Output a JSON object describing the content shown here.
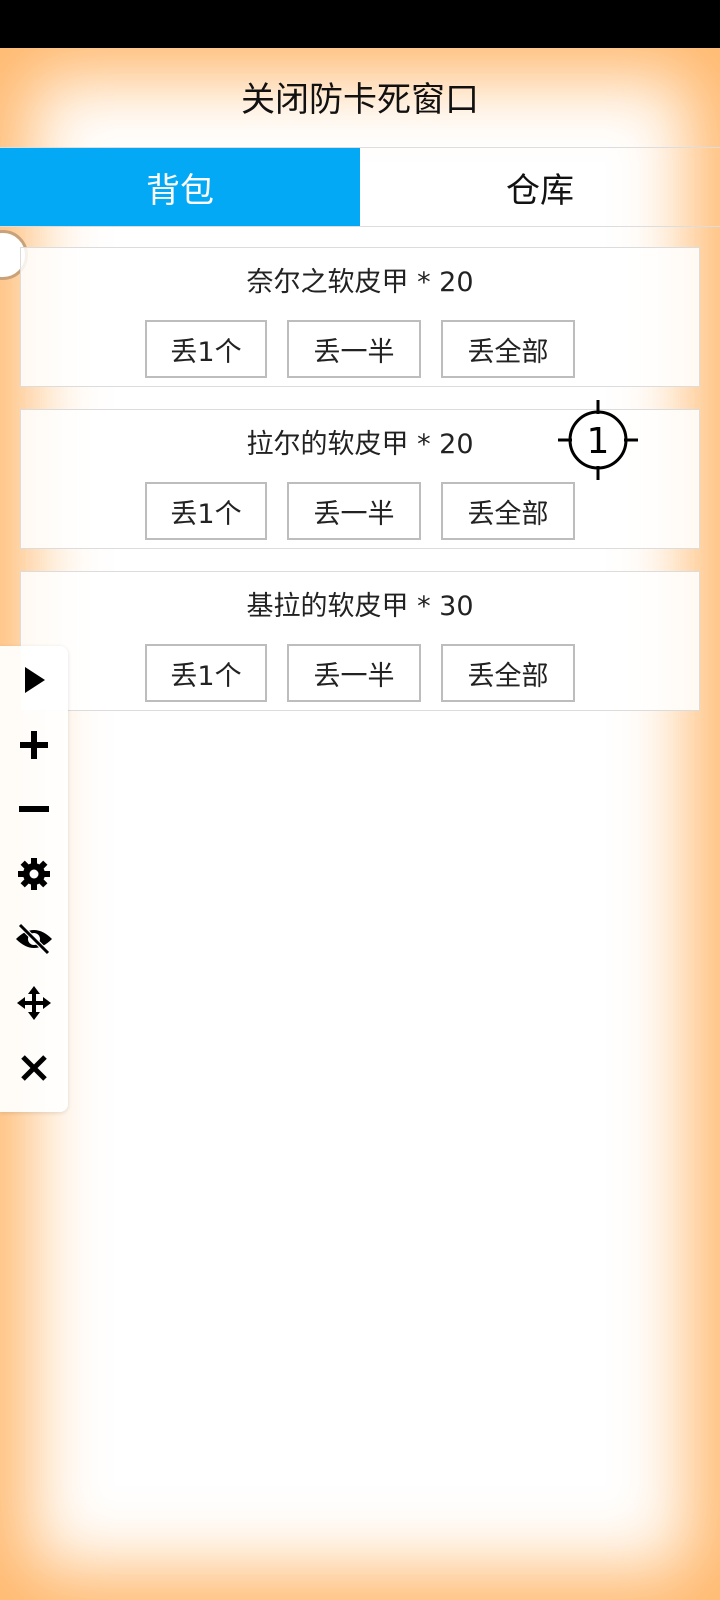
{
  "window": {
    "title": "关闭防卡死窗口"
  },
  "tabs": [
    {
      "label": "背包",
      "active": true
    },
    {
      "label": "仓库",
      "active": false
    }
  ],
  "items": [
    {
      "name": "奈尔之软皮甲 * 20",
      "btn_one": "丢1个",
      "btn_half": "丢一半",
      "btn_all": "丢全部"
    },
    {
      "name": "拉尔的软皮甲 * 20",
      "btn_one": "丢1个",
      "btn_half": "丢一半",
      "btn_all": "丢全部"
    },
    {
      "name": "基拉的软皮甲 * 30",
      "btn_one": "丢1个",
      "btn_half": "丢一半",
      "btn_all": "丢全部"
    }
  ],
  "crosshair": {
    "label": "1"
  },
  "toolbar": {
    "icons": [
      "play-icon",
      "plus-icon",
      "minus-icon",
      "gear-icon",
      "eye-off-icon",
      "move-icon",
      "close-icon"
    ]
  },
  "colors": {
    "accent": "#03a9f4",
    "frame_glow": "#ffa03c"
  }
}
